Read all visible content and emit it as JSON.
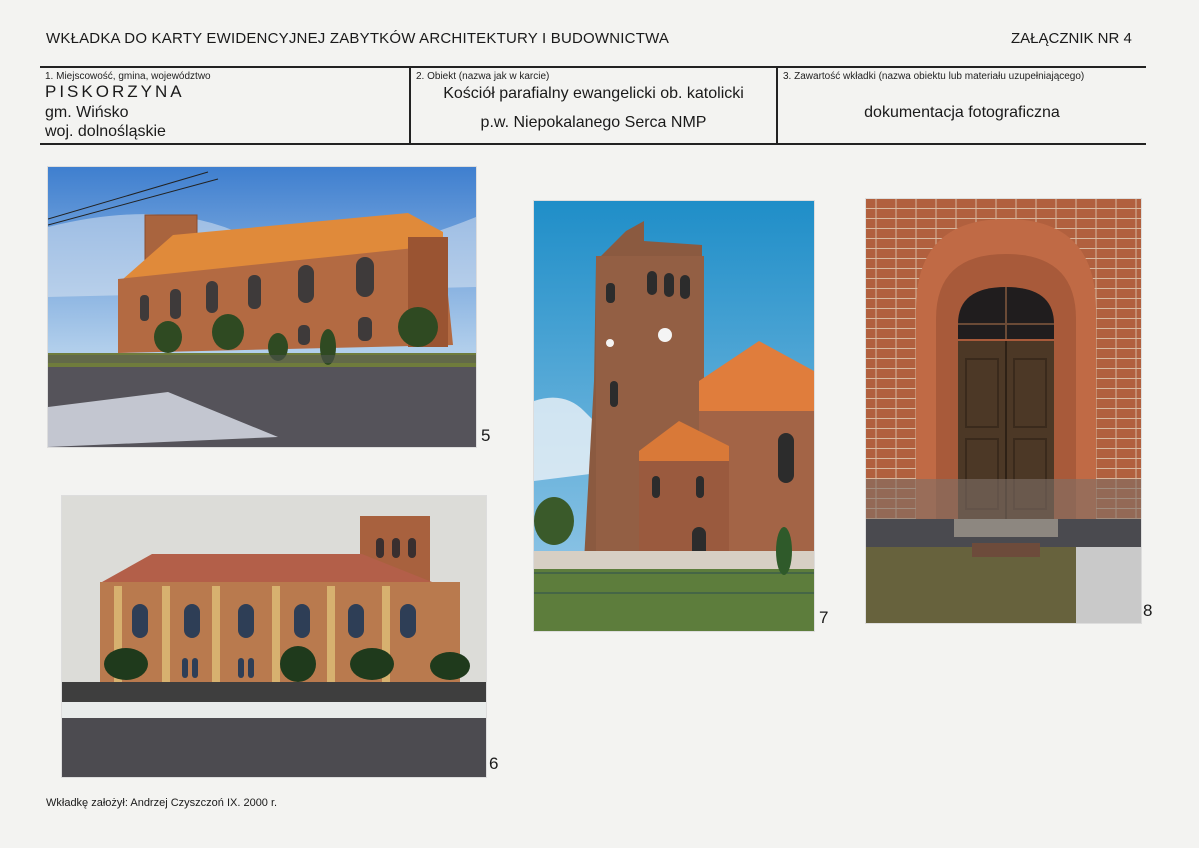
{
  "header": {
    "title": "WKŁADKA DO KARTY EWIDENCYJNEJ ZABYTKÓW ARCHITEKTURY I BUDOWNICTWA",
    "annex": "ZAŁĄCZNIK NR 4"
  },
  "fields": {
    "location": {
      "label": "1. Miejscowość, gmina, województwo",
      "place": "PISKORZYNA",
      "commune": "gm. Wińsko",
      "voivodeship": "woj. dolnośląskie"
    },
    "object": {
      "label": "2. Obiekt (nazwa jak w karcie)",
      "line1": "Kościół parafialny ewangelicki ob. katolicki",
      "line2": "p.w. Niepokalanego Serca NMP"
    },
    "contents": {
      "label": "3. Zawartość wkładki (nazwa obiektu lub materiału uzupełniającego)",
      "value": "dokumentacja fotograficzna"
    }
  },
  "photos": [
    {
      "number": "5"
    },
    {
      "number": "6"
    },
    {
      "number": "7"
    },
    {
      "number": "8"
    }
  ],
  "footer": {
    "text": "Wkładkę założył: Andrzej Czyszczoń IX. 2000  r."
  }
}
